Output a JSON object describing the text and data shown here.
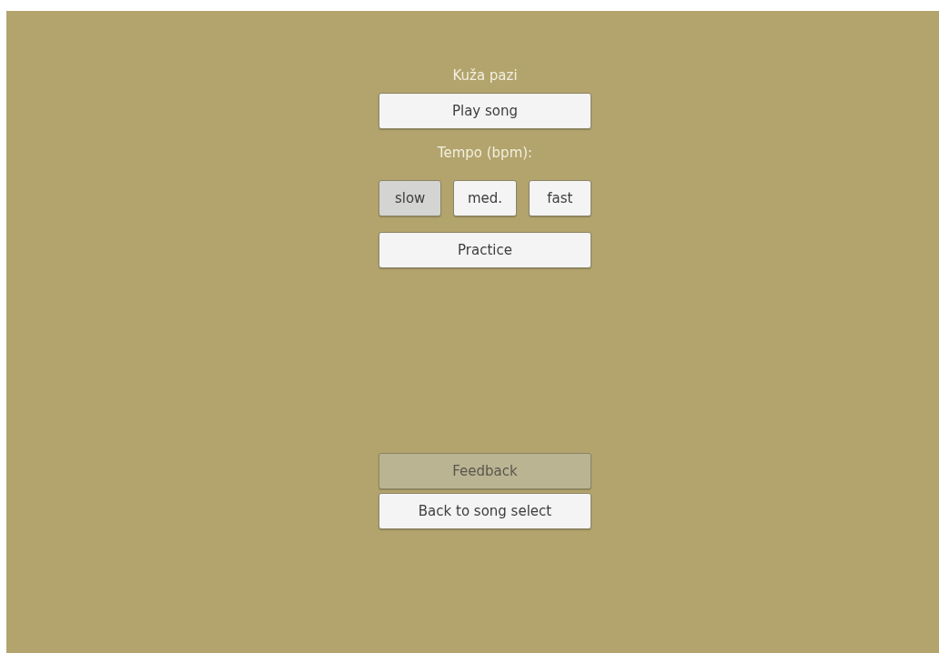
{
  "title": "Kuža pazi",
  "play_button": {
    "label": "Play song"
  },
  "tempo": {
    "label": "Tempo (bpm):",
    "options": [
      {
        "label": "slow",
        "selected": true
      },
      {
        "label": "med.",
        "selected": false
      },
      {
        "label": "fast",
        "selected": false
      }
    ]
  },
  "practice_button": {
    "label": "Practice"
  },
  "bottom_buttons": [
    {
      "label": "Feedback",
      "disabled": true
    },
    {
      "label": "Back to song select",
      "disabled": false
    }
  ]
}
